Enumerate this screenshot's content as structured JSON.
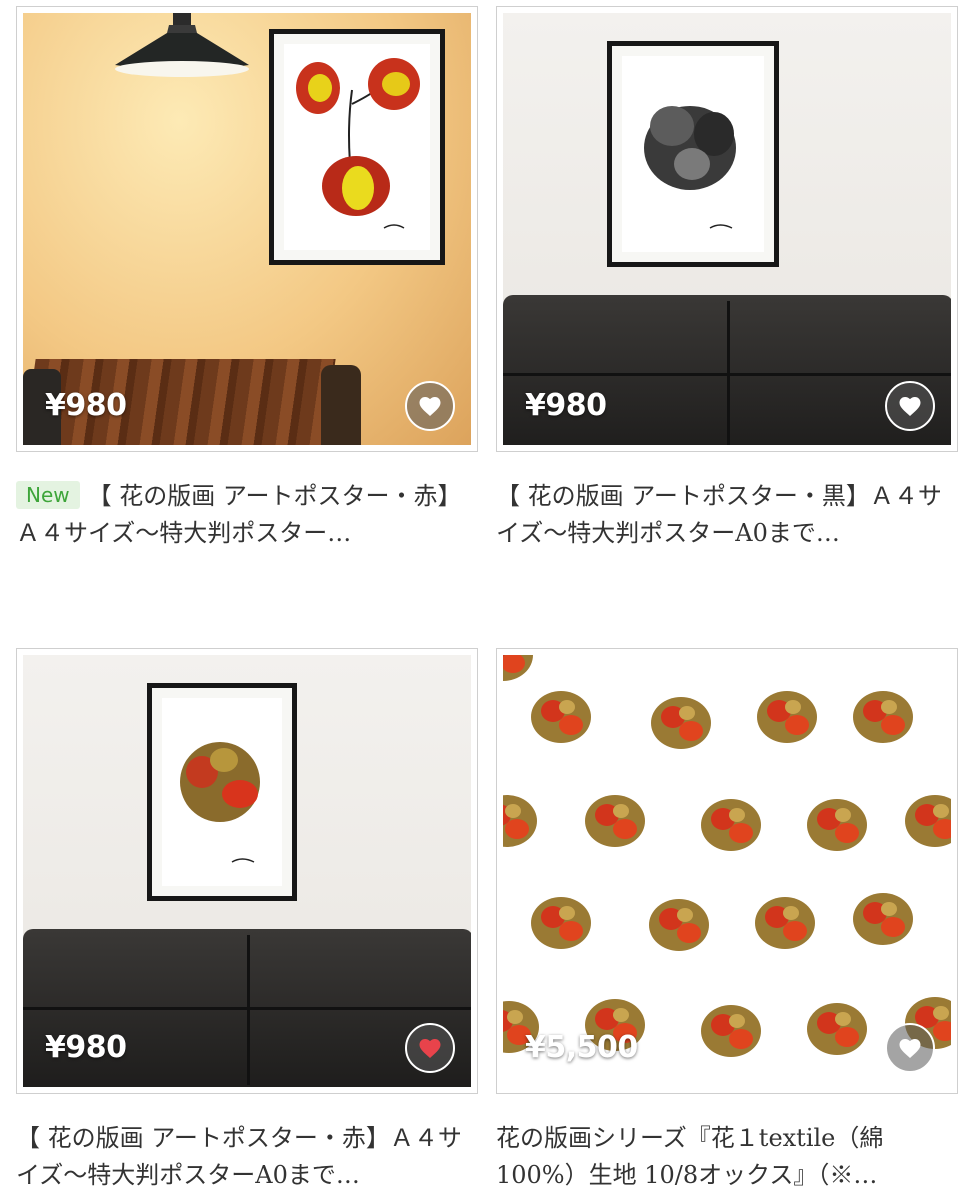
{
  "products": [
    {
      "price": "¥980",
      "badge": "New",
      "title": "【 花の版画 アートポスター・赤】Ａ４サイズ〜特大判ポスター…",
      "liked": false
    },
    {
      "price": "¥980",
      "badge": "",
      "title": "【 花の版画 アートポスター・黒】Ａ４サイズ〜特大判ポスターA0まで…",
      "liked": false
    },
    {
      "price": "¥980",
      "badge": "",
      "title": "【 花の版画 アートポスター・赤】Ａ４サイズ〜特大判ポスターA0まで…",
      "liked": true
    },
    {
      "price": "¥5,500",
      "badge": "",
      "title": "花の版画シリーズ『花１textile（綿100%）生地 10/8オックス』（※…",
      "liked": false
    }
  ],
  "colors": {
    "like_active": "#e8434b",
    "like_inactive": "#ffffff",
    "badge_text": "#3ea53a",
    "badge_bg": "#e4f3e1"
  },
  "icons": {
    "like": "heart-icon"
  }
}
